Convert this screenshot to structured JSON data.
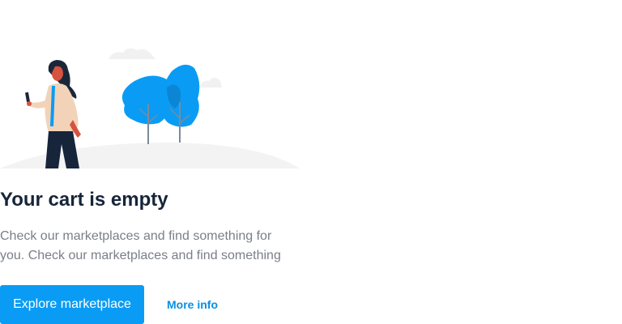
{
  "empty_state": {
    "title": "Your cart is empty",
    "description": "Check our marketplaces and find something for you. Check our marketplaces and find something",
    "primary_button_label": "Explore marketplace",
    "secondary_link_label": "More info"
  },
  "illustration": {
    "subject": "person-with-phone-and-trees",
    "colors": {
      "tree": "#0a9cf4",
      "ground": "#f3f3f3",
      "coat": "#f2d3b8",
      "hair": "#1b2738",
      "pants": "#16253a",
      "skin": "#d6533f"
    }
  },
  "colors": {
    "accent": "#0a9cf4",
    "title_text": "#16253a",
    "body_text": "#7a7f87",
    "link_text": "#0a8fe0"
  }
}
